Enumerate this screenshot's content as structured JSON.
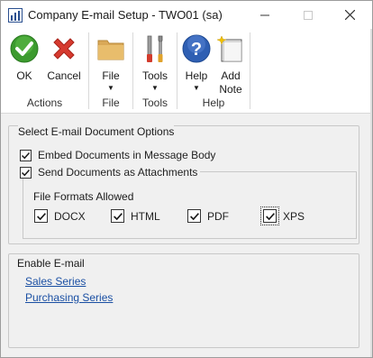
{
  "window": {
    "title": "Company E-mail Setup  -  TWO01 (sa)"
  },
  "ribbon": {
    "groups": [
      {
        "label": "Actions",
        "buttons": [
          {
            "label": "OK",
            "icon": "ok-check-icon"
          },
          {
            "label": "Cancel",
            "icon": "cancel-x-icon"
          }
        ]
      },
      {
        "label": "File",
        "buttons": [
          {
            "label": "File",
            "icon": "folder-icon"
          }
        ]
      },
      {
        "label": "Tools",
        "buttons": [
          {
            "label": "Tools",
            "icon": "tools-icon"
          }
        ]
      },
      {
        "label": "Help",
        "buttons": [
          {
            "label": "Help",
            "icon": "help-icon"
          },
          {
            "label": "Add Note",
            "label_line1": "Add",
            "label_line2": "Note",
            "icon": "add-note-icon"
          }
        ]
      }
    ]
  },
  "email_options": {
    "title": "Select E-mail Document Options",
    "embed_label": "Embed Documents in Message Body",
    "embed_checked": true,
    "attach_label": "Send Documents as Attachments",
    "attach_checked": true,
    "formats_title": "File Formats Allowed",
    "formats": [
      {
        "label": "DOCX",
        "checked": true
      },
      {
        "label": "HTML",
        "checked": true
      },
      {
        "label": "PDF",
        "checked": true
      },
      {
        "label": "XPS",
        "checked": true
      }
    ]
  },
  "enable_email": {
    "title": "Enable E-mail",
    "links": [
      "Sales Series",
      "Purchasing Series"
    ]
  },
  "colors": {
    "ok_green": "#3c9a2e",
    "cancel_red": "#d63a2f",
    "help_blue": "#2f5fb3",
    "link_blue": "#1a4fa3"
  }
}
